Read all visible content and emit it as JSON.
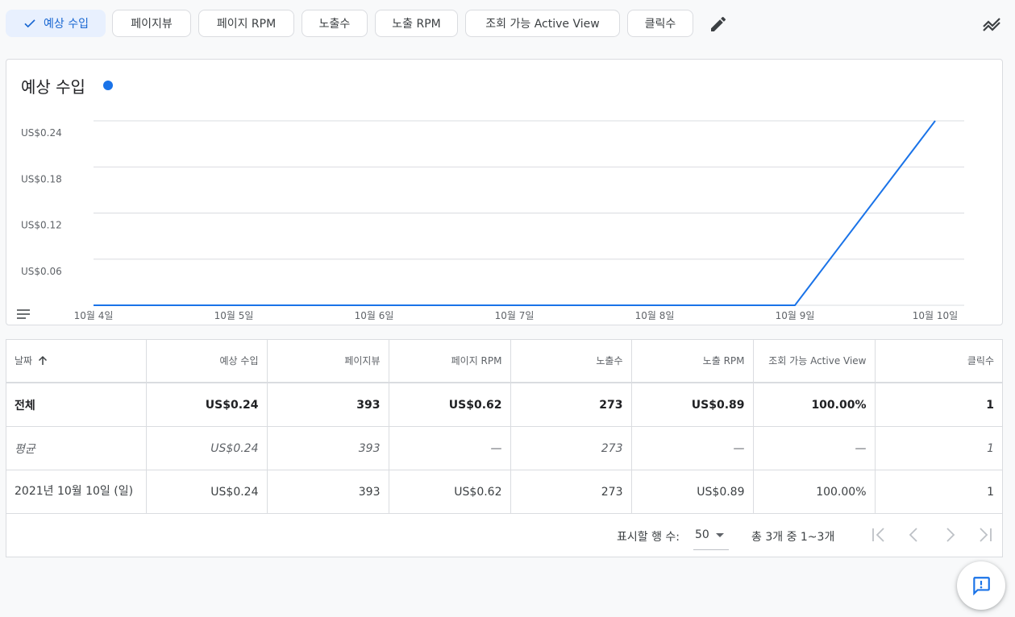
{
  "chips": [
    {
      "label": "예상 수입",
      "selected": true
    },
    {
      "label": "페이지뷰",
      "selected": false
    },
    {
      "label": "페이지 RPM",
      "selected": false
    },
    {
      "label": "노출수",
      "selected": false
    },
    {
      "label": "노출 RPM",
      "selected": false
    },
    {
      "label": "조회 가능 Active View",
      "selected": false
    },
    {
      "label": "클릭수",
      "selected": false
    }
  ],
  "icons": {
    "check": "check-icon",
    "edit": "pencil-icon",
    "compare": "trend-compare-icon",
    "chart_menu": "menu-lines-icon",
    "sort": "arrow-up-icon",
    "feedback": "feedback-icon"
  },
  "colors": {
    "accent": "#1a73e8",
    "selected_chip_bg": "#e8f0fe",
    "selected_chip_text": "#1967d2"
  },
  "chart_data": {
    "type": "line",
    "title": "예상 수입",
    "categories": [
      "10월 4일",
      "10월 5일",
      "10월 6일",
      "10월 7일",
      "10월 8일",
      "10월 9일",
      "10월 10일"
    ],
    "series": [
      {
        "name": "",
        "values": [
          0,
          0,
          0,
          0,
          0,
          0,
          0.24
        ]
      }
    ],
    "y_ticks": [
      "US$0.24",
      "US$0.18",
      "US$0.12",
      "US$0.06"
    ],
    "ylim": [
      0,
      0.24
    ],
    "grid": true
  },
  "table": {
    "headers": [
      "날짜",
      "예상 수입",
      "페이지뷰",
      "페이지 RPM",
      "노출수",
      "노출 RPM",
      "조회 가능 Active View",
      "클릭수"
    ],
    "rows": [
      [
        "전체",
        "US$0.24",
        "393",
        "US$0.62",
        "273",
        "US$0.89",
        "100.00%",
        "1"
      ],
      [
        "평균",
        "US$0.24",
        "393",
        "—",
        "273",
        "—",
        "—",
        "1"
      ],
      [
        "2021년 10월 10일 (일)",
        "US$0.24",
        "393",
        "US$0.62",
        "273",
        "US$0.89",
        "100.00%",
        "1"
      ]
    ]
  },
  "pagination": {
    "rows_label": "표시할 행 수:",
    "rows_value": "50",
    "range_text": "총 3개 중 1~3개"
  }
}
